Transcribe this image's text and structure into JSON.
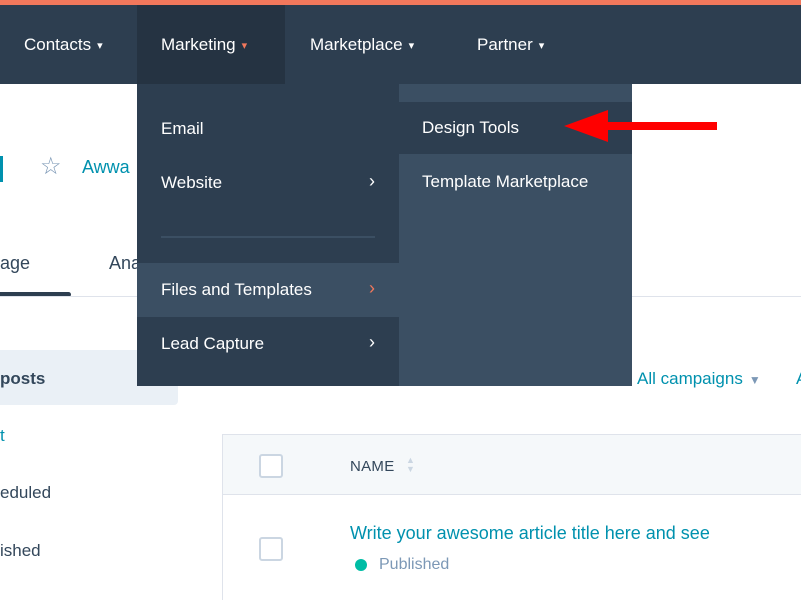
{
  "nav": {
    "items": [
      {
        "label": "Contacts"
      },
      {
        "label": "Marketing"
      },
      {
        "label": "Marketplace"
      },
      {
        "label": "Partner"
      }
    ],
    "chevron": "⌵"
  },
  "page": {
    "title": "Awwa",
    "tabs": [
      "age",
      "Ana"
    ],
    "sidebar": {
      "active": "posts",
      "link": "t",
      "items": [
        "eduled",
        "ished"
      ]
    },
    "filter": {
      "label": "All campaigns",
      "next": "A"
    },
    "table": {
      "col_name": "NAME",
      "row_title": "Write your awesome article title here and see",
      "row_status": "Published"
    }
  },
  "menu": {
    "items": [
      {
        "label": "Email"
      },
      {
        "label": "Website"
      },
      {
        "label": "Files and Templates"
      },
      {
        "label": "Lead Capture"
      }
    ],
    "submenu": [
      {
        "label": "Design Tools"
      },
      {
        "label": "Template Marketplace"
      }
    ]
  },
  "colors": {
    "nav_bg": "#2d3e50",
    "accent": "#f2785c",
    "link": "#0091ae",
    "annotation": "#ff0000",
    "status_published": "#00bda5"
  },
  "icons": [
    "chevron-down-icon",
    "chevron-right-icon",
    "star-icon",
    "sort-icon",
    "red-arrow-annotation"
  ]
}
